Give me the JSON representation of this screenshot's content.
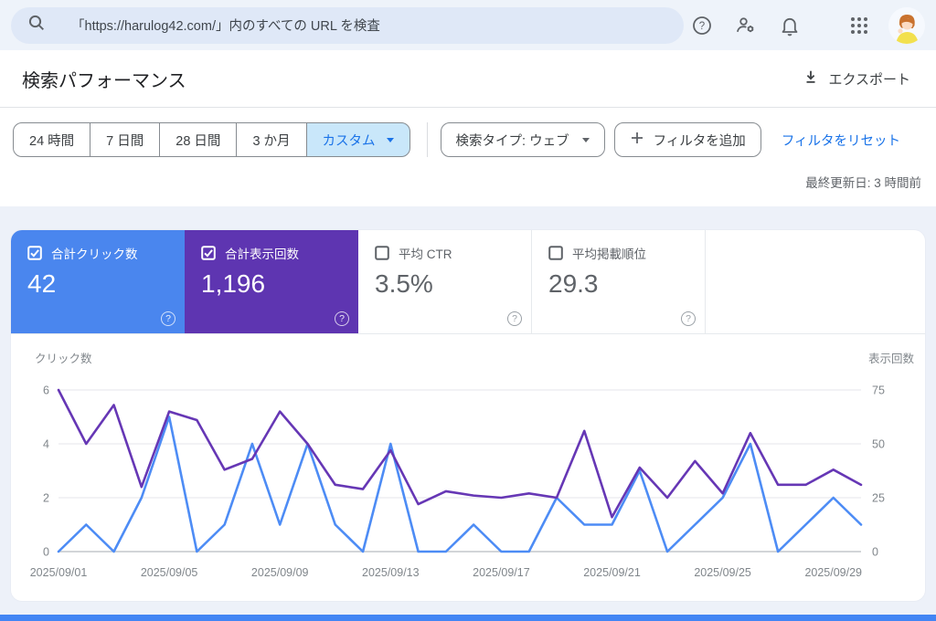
{
  "colors": {
    "clicks_line": "#4d8cf5",
    "impressions_line": "#6637b5",
    "clicks_card_bg": "#4a86ee",
    "impressions_card_bg": "#5e35b1",
    "selected_tab_bg": "#c9e7fa",
    "link_blue": "#1a73e8",
    "footer_bar": "#4285f4"
  },
  "header": {
    "search_text": "「https://harulog42.com/」内のすべての URL を検査"
  },
  "page": {
    "title": "検索パフォーマンス",
    "export_label": "エクスポート",
    "last_updated": "最終更新日: 3 時間前"
  },
  "filters": {
    "date_tabs": [
      {
        "label": "24 時間",
        "selected": false
      },
      {
        "label": "7 日間",
        "selected": false
      },
      {
        "label": "28 日間",
        "selected": false
      },
      {
        "label": "3 か月",
        "selected": false
      },
      {
        "label": "カスタム",
        "selected": true
      }
    ],
    "search_type": "検索タイプ: ウェブ",
    "add_filter": "フィルタを追加",
    "reset": "フィルタをリセット"
  },
  "metrics": {
    "help_glyph": "?",
    "cards": [
      {
        "label": "合計クリック数",
        "value": "42",
        "checked": true,
        "style": "blue"
      },
      {
        "label": "合計表示回数",
        "value": "1,196",
        "checked": true,
        "style": "purple"
      },
      {
        "label": "平均 CTR",
        "value": "3.5%",
        "checked": false,
        "style": "white"
      },
      {
        "label": "平均掲載順位",
        "value": "29.3",
        "checked": false,
        "style": "white"
      }
    ]
  },
  "chart_data": {
    "type": "line",
    "title": "",
    "ylabel_left": "クリック数",
    "ylabel_right": "表示回数",
    "yticks_left": [
      6,
      4,
      2,
      0
    ],
    "yticks_right": [
      75,
      50,
      25,
      0
    ],
    "ylim_left": [
      0,
      6
    ],
    "ylim_right": [
      0,
      75
    ],
    "grid": true,
    "x": [
      "2025/09/01",
      "2025/09/02",
      "2025/09/03",
      "2025/09/04",
      "2025/09/05",
      "2025/09/06",
      "2025/09/07",
      "2025/09/08",
      "2025/09/09",
      "2025/09/10",
      "2025/09/11",
      "2025/09/12",
      "2025/09/13",
      "2025/09/14",
      "2025/09/15",
      "2025/09/16",
      "2025/09/17",
      "2025/09/18",
      "2025/09/19",
      "2025/09/20",
      "2025/09/21",
      "2025/09/22",
      "2025/09/23",
      "2025/09/24",
      "2025/09/25",
      "2025/09/26",
      "2025/09/27",
      "2025/09/28",
      "2025/09/29",
      "2025/09/30"
    ],
    "x_tick_indices": [
      0,
      4,
      8,
      12,
      16,
      20,
      24,
      28
    ],
    "series": [
      {
        "name": "クリック数",
        "axis": "left",
        "color": "#4d8cf5",
        "total": 42,
        "values": [
          0,
          1,
          0,
          2,
          5,
          0,
          1,
          4,
          1,
          4,
          1,
          0,
          4,
          0,
          0,
          1,
          0,
          0,
          2,
          1,
          1,
          3,
          0,
          1,
          2,
          4,
          0,
          1,
          2,
          1
        ]
      },
      {
        "name": "表示回数",
        "axis": "right",
        "color": "#6637b5",
        "total": 1196,
        "values": [
          75,
          50,
          68,
          30,
          65,
          61,
          38,
          43,
          65,
          50,
          31,
          29,
          47,
          22,
          28,
          26,
          25,
          27,
          25,
          56,
          16,
          39,
          25,
          42,
          27,
          55,
          31,
          31,
          38,
          31
        ]
      }
    ]
  }
}
